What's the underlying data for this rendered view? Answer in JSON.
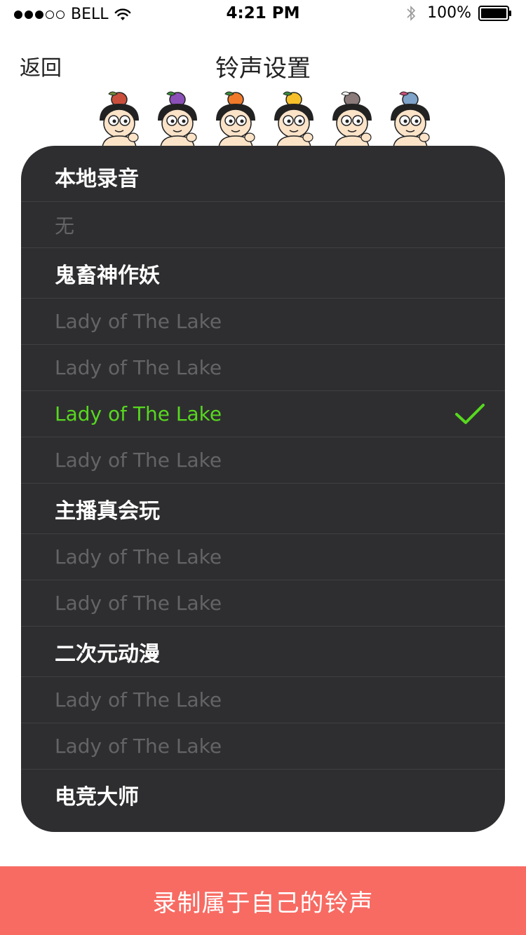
{
  "status_bar": {
    "carrier": "BELL",
    "signal_bars_filled": 3,
    "signal_bars_total": 5,
    "time": "4:21 PM",
    "battery": "100%"
  },
  "nav": {
    "back_label": "返回",
    "title": "铃声设置"
  },
  "mascots": [
    {
      "name": "old-man-mascot",
      "hat": "#c94f3c",
      "leaf": "#6b8a3a"
    },
    {
      "name": "gourd-brother-purple",
      "hat": "#8b4fb8",
      "leaf": "#3a8a3a"
    },
    {
      "name": "gourd-brother-orange",
      "hat": "#f07a2a",
      "leaf": "#3a8a3a"
    },
    {
      "name": "gourd-brother-yellow",
      "hat": "#f5c02a",
      "leaf": "#3a8a3a"
    },
    {
      "name": "bull-demon-mascot",
      "hat": "#8a7a7a",
      "leaf": "#ffffff"
    },
    {
      "name": "snake-demon-mascot",
      "hat": "#7fa3c9",
      "leaf": "#c94f7a"
    }
  ],
  "ringtones": [
    {
      "type": "header",
      "label": "本地录音"
    },
    {
      "type": "item",
      "label": "无",
      "selected": false
    },
    {
      "type": "header",
      "label": "鬼畜神作妖"
    },
    {
      "type": "item",
      "label": "Lady of The Lake",
      "selected": false
    },
    {
      "type": "item",
      "label": "Lady of The Lake",
      "selected": false
    },
    {
      "type": "item",
      "label": "Lady of The Lake",
      "selected": true
    },
    {
      "type": "item",
      "label": "Lady of The Lake",
      "selected": false
    },
    {
      "type": "header",
      "label": "主播真会玩"
    },
    {
      "type": "item",
      "label": "Lady of The Lake",
      "selected": false
    },
    {
      "type": "item",
      "label": "Lady of The Lake",
      "selected": false
    },
    {
      "type": "header",
      "label": "二次元动漫"
    },
    {
      "type": "item",
      "label": "Lady of The Lake",
      "selected": false
    },
    {
      "type": "item",
      "label": "Lady of The Lake",
      "selected": false
    },
    {
      "type": "header",
      "label": "电竞大师"
    }
  ],
  "record_button_label": "录制属于自己的铃声",
  "colors": {
    "panel_bg": "#2e2e30",
    "selected_text": "#57d81f",
    "record_button_bg": "#f76b63"
  }
}
